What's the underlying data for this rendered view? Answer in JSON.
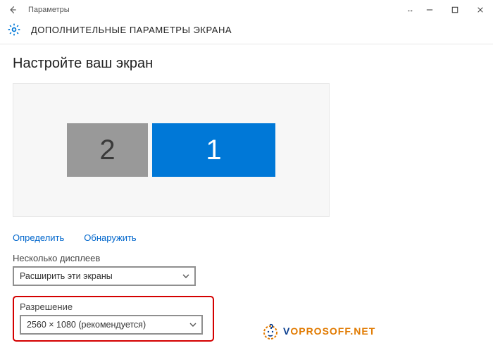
{
  "window": {
    "title": "Параметры"
  },
  "header": {
    "title": "ДОПОЛНИТЕЛЬНЫЕ ПАРАМЕТРЫ ЭКРАНА"
  },
  "section": {
    "title": "Настройте ваш экран"
  },
  "monitors": {
    "secondary_label": "2",
    "primary_label": "1"
  },
  "links": {
    "identify": "Определить",
    "detect": "Обнаружить"
  },
  "multiple_displays": {
    "label": "Несколько дисплеев",
    "selected": "Расширить эти экраны"
  },
  "resolution": {
    "label": "Разрешение",
    "selected": "2560 × 1080 (рекомендуется)"
  },
  "watermark": {
    "text": "VOPROSOFF.NET"
  }
}
